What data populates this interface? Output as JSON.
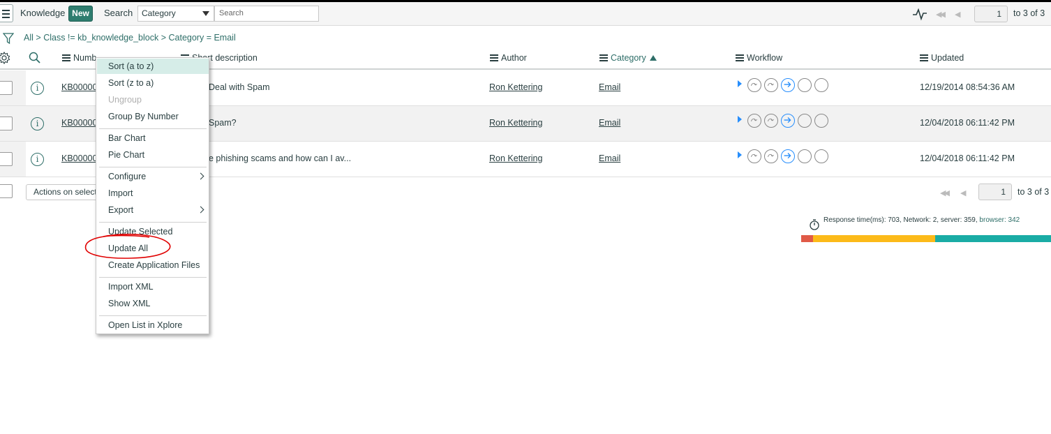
{
  "header": {
    "title": "Knowledge",
    "new_label": "New",
    "search_label": "Search",
    "search_field": "Category",
    "search_placeholder": "Search",
    "page_value": "1",
    "page_of": "to 3 of 3"
  },
  "breadcrumb": {
    "items": [
      "All",
      "Class != kb_knowledge_block",
      "Category = Email"
    ],
    "separator": ">"
  },
  "columns": {
    "number": "Numb",
    "short_description": "Short description",
    "author": "Author",
    "category": "Category",
    "workflow": "Workflow",
    "updated": "Updated"
  },
  "rows": [
    {
      "number": "KB000000",
      "short_description": "Deal with Spam",
      "author": "Ron Kettering",
      "category": "Email",
      "updated": "12/19/2014 08:54:36 AM"
    },
    {
      "number": "KB000000",
      "short_description": "Spam?",
      "author": "Ron Kettering",
      "category": "Email",
      "updated": "12/04/2018 06:11:42 PM"
    },
    {
      "number": "KB000000",
      "short_description": "e phishing scams and how can I av...",
      "author": "Ron Kettering",
      "category": "Email",
      "updated": "12/04/2018 06:11:42 PM"
    }
  ],
  "footer": {
    "actions_label": "Actions on selected rows...",
    "page_value": "1",
    "page_of": "to 3 of 3"
  },
  "response": {
    "text": "Response time(ms): 703, Network: 2, server: 359, ",
    "browser_text": "browser: 342",
    "network_ms": 2,
    "server_ms": 359,
    "browser_ms": 342
  },
  "context_menu": {
    "items": [
      "Sort (a to z)",
      "Sort (z to a)",
      "Ungroup",
      "Group By Number",
      "Bar Chart",
      "Pie Chart",
      "Configure",
      "Import",
      "Export",
      "Update Selected",
      "Update All",
      "Create Application Files",
      "Import XML",
      "Show XML",
      "Open List in Xplore"
    ]
  },
  "colors": {
    "accent": "#2e6e68",
    "new_button": "#2e7d6f",
    "highlight": "#d6ede8",
    "annotation": "#e00000",
    "perf_red": "#e05a47",
    "perf_yellow": "#fcba19",
    "perf_teal": "#1aaca5"
  }
}
